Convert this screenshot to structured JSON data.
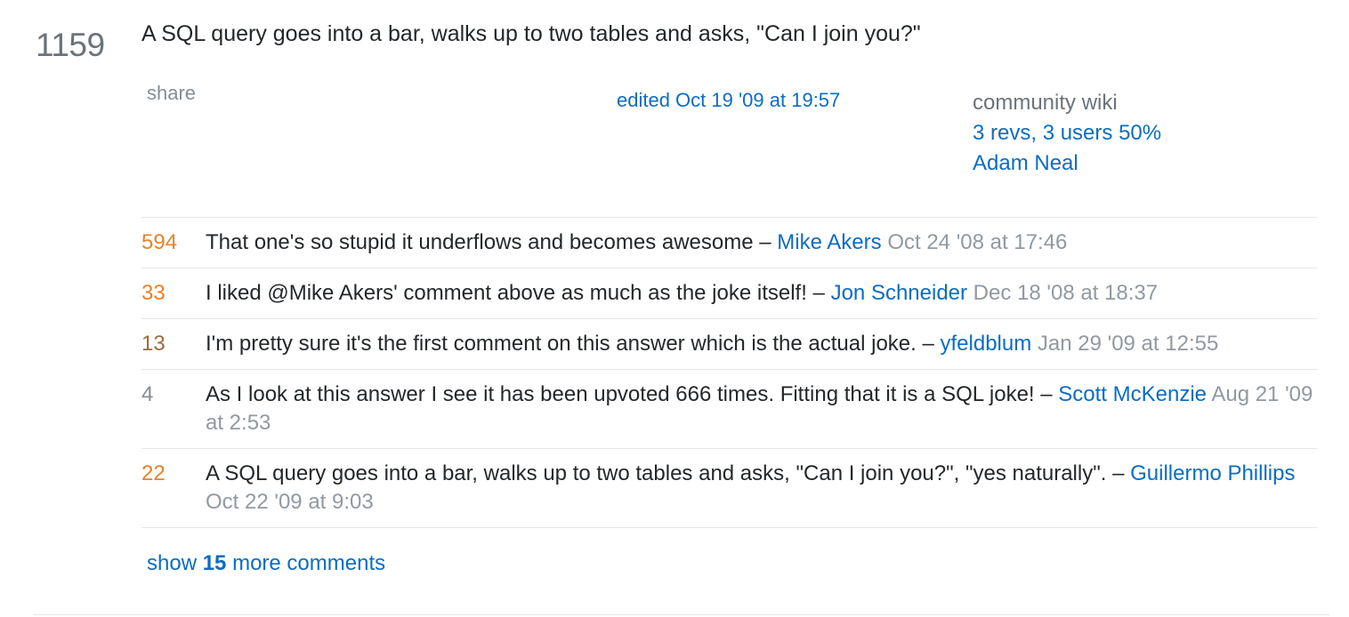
{
  "answer": {
    "vote_count": "1159",
    "text": "A SQL query goes into a bar, walks up to two tables and asks, \"Can I join you?\"",
    "share_label": "share",
    "edited_label": "edited Oct 19 '09 at 19:57",
    "community_wiki": {
      "label": "community wiki",
      "revisions": "3 revs, 3 users 50%",
      "user": "Adam Neal"
    }
  },
  "comments": [
    {
      "score": "594",
      "score_color": "#e8812b",
      "text": "That one's so stupid it underflows and becomes awesome – ",
      "user": "Mike Akers",
      "date": " Oct 24 '08 at 17:46"
    },
    {
      "score": "33",
      "score_color": "#e8812b",
      "text": "I liked @Mike Akers' comment above as much as the joke itself! – ",
      "user": "Jon Schneider",
      "date": " Dec 18 '08 at 18:37"
    },
    {
      "score": "13",
      "score_color": "#9c6c3c",
      "text": "I'm pretty sure it's the first comment on this answer which is the actual joke. – ",
      "user": "yfeldblum",
      "date": " Jan 29 '09 at 12:55"
    },
    {
      "score": "4",
      "score_color": "#848d95",
      "text": "As I look at this answer I see it has been upvoted 666 times. Fitting that it is a SQL joke! – ",
      "user": "Scott McKenzie",
      "date": " Aug 21 '09 at 2:53"
    },
    {
      "score": "22",
      "score_color": "#e8812b",
      "text": "A SQL query goes into a bar, walks up to two tables and asks, \"Can I join you?\", \"yes naturally\". – ",
      "user": "Guillermo Phillips",
      "date": " Oct 22 '09 at 9:03"
    }
  ],
  "show_more": {
    "prefix": "show ",
    "count": "15",
    "suffix": " more comments"
  }
}
